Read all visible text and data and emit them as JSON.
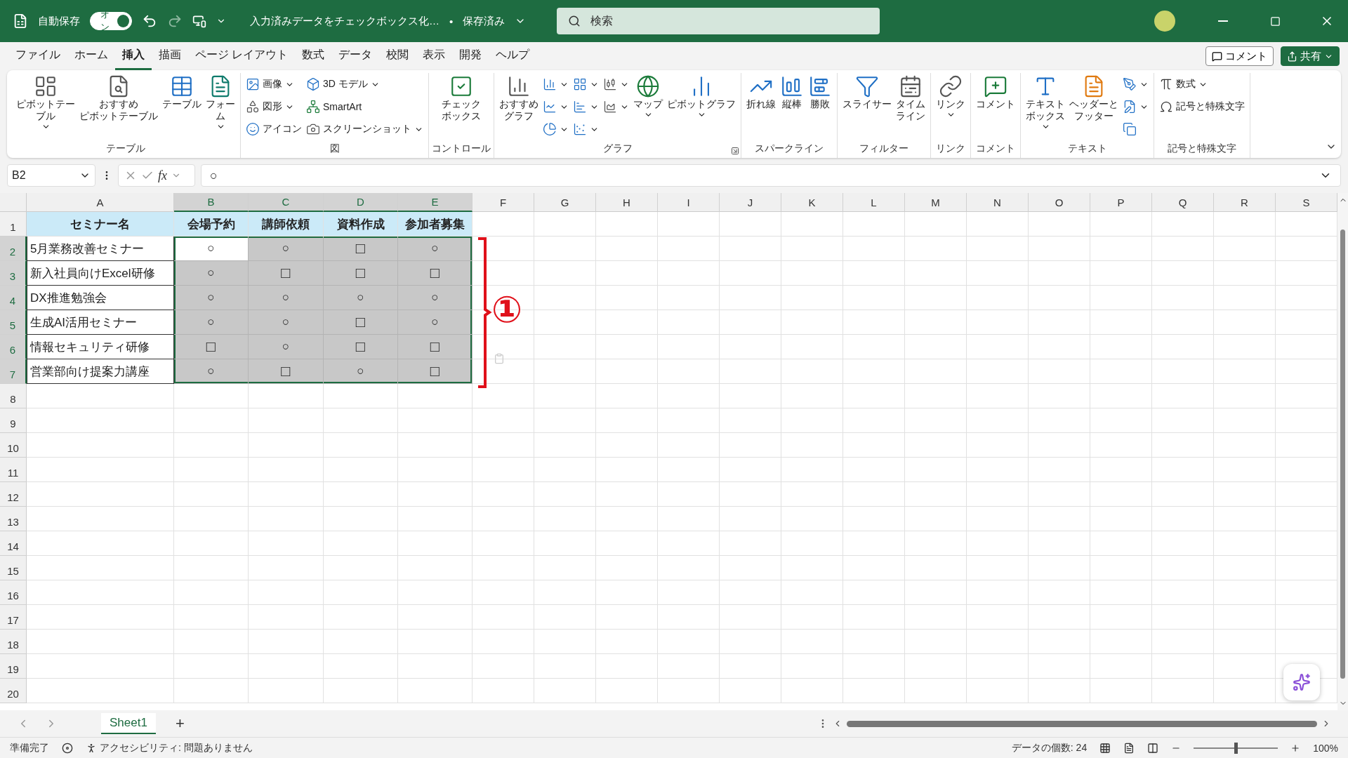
{
  "title_bar": {
    "autosave_label": "自動保存",
    "autosave": {
      "label": "オン",
      "on": true
    },
    "redo_disabled": true,
    "document_title": "入力済みデータをチェックボックス化…",
    "separator": "•",
    "save_status": "保存済み",
    "search": {
      "placeholder": "検索"
    }
  },
  "menu": {
    "tabs": [
      {
        "label": "ファイル",
        "selected": false
      },
      {
        "label": "ホーム",
        "selected": false
      },
      {
        "label": "挿入",
        "selected": true
      },
      {
        "label": "描画",
        "selected": false
      },
      {
        "label": "ページ レイアウト",
        "selected": false
      },
      {
        "label": "数式",
        "selected": false
      },
      {
        "label": "データ",
        "selected": false
      },
      {
        "label": "校閲",
        "selected": false
      },
      {
        "label": "表示",
        "selected": false
      },
      {
        "label": "開発",
        "selected": false
      },
      {
        "label": "ヘルプ",
        "selected": false
      }
    ],
    "comment_button": "コメント",
    "share_button": "共有"
  },
  "ribbon": [
    {
      "label": "テーブル",
      "items": [
        {
          "kind": "large",
          "lines": [
            "ピボットテー",
            "ブル"
          ],
          "dropdown": true
        },
        {
          "kind": "large",
          "lines": [
            "おすすめ",
            "ピボットテーブル"
          ],
          "dropdown": false
        },
        {
          "kind": "large",
          "lines": [
            "テーブル"
          ],
          "dropdown": false
        },
        {
          "kind": "large",
          "lines": [
            "フォー",
            "ム"
          ],
          "dropdown": true
        }
      ]
    },
    {
      "label": "図",
      "items": [
        {
          "kind": "stack",
          "entries": [
            {
              "label": "画像",
              "dropdown": true
            },
            {
              "label": "図形",
              "dropdown": true
            },
            {
              "label": "アイコン",
              "dropdown": false
            }
          ]
        },
        {
          "kind": "stack",
          "entries": [
            {
              "label": "3D モデル",
              "dropdown": true
            },
            {
              "label": "SmartArt",
              "dropdown": false
            },
            {
              "label": "スクリーンショット",
              "dropdown": true
            }
          ]
        }
      ]
    },
    {
      "label": "コントロール",
      "items": [
        {
          "kind": "large",
          "lines": [
            "チェック",
            "ボックス"
          ],
          "dropdown": false
        }
      ]
    },
    {
      "label": "グラフ",
      "launcher": true,
      "items": [
        {
          "kind": "large",
          "lines": [
            "おすすめ",
            "グラフ"
          ],
          "dropdown": false
        },
        {
          "kind": "stack",
          "entries": [
            {
              "dropdown": true
            },
            {
              "dropdown": true
            },
            {
              "dropdown": true
            }
          ]
        },
        {
          "kind": "stack",
          "entries": [
            {
              "dropdown": true
            },
            {
              "dropdown": true
            },
            {
              "dropdown": true
            }
          ]
        },
        {
          "kind": "stack",
          "entries": [
            {
              "dropdown": true
            },
            {
              "dropdown": true
            }
          ]
        },
        {
          "kind": "large",
          "lines": [
            "マップ"
          ],
          "dropdown": true
        },
        {
          "kind": "large",
          "lines": [
            "ピボットグラフ"
          ],
          "dropdown": true
        }
      ]
    },
    {
      "label": "スパークライン",
      "items": [
        {
          "kind": "large",
          "lines": [
            "折れ線"
          ],
          "dropdown": false
        },
        {
          "kind": "large",
          "lines": [
            "縦棒"
          ],
          "dropdown": false
        },
        {
          "kind": "large",
          "lines": [
            "勝敗"
          ],
          "dropdown": false
        }
      ]
    },
    {
      "label": "フィルター",
      "items": [
        {
          "kind": "large",
          "lines": [
            "スライサー"
          ],
          "dropdown": false
        },
        {
          "kind": "large",
          "lines": [
            "タイム",
            "ライン"
          ],
          "dropdown": false
        }
      ]
    },
    {
      "label": "リンク",
      "items": [
        {
          "kind": "large",
          "lines": [
            "リンク"
          ],
          "dropdown": true
        }
      ]
    },
    {
      "label": "コメント",
      "items": [
        {
          "kind": "large",
          "lines": [
            "コメント"
          ],
          "dropdown": false
        }
      ]
    },
    {
      "label": "テキスト",
      "items": [
        {
          "kind": "large",
          "lines": [
            "テキスト",
            "ボックス"
          ],
          "dropdown": true
        },
        {
          "kind": "large",
          "lines": [
            "ヘッダーと",
            "フッター"
          ],
          "dropdown": false
        },
        {
          "kind": "stack",
          "entries": [
            {
              "dropdown": true
            },
            {
              "dropdown": true
            },
            {
              "dropdown": false
            }
          ]
        }
      ]
    },
    {
      "label": "記号と特殊文字",
      "items": [
        {
          "kind": "stack",
          "entries": [
            {
              "label": "数式",
              "dropdown": true
            },
            {
              "label": "記号と特殊文字",
              "dropdown": false
            }
          ]
        }
      ]
    }
  ],
  "formula_bar": {
    "name_box": "B2",
    "fx": "fx",
    "value": "○"
  },
  "sheet": {
    "columns": [
      {
        "label": "A",
        "selected": false
      },
      {
        "label": "B",
        "selected": true
      },
      {
        "label": "C",
        "selected": true
      },
      {
        "label": "D",
        "selected": true
      },
      {
        "label": "E",
        "selected": true
      },
      {
        "label": "F",
        "selected": false
      },
      {
        "label": "G",
        "selected": false
      },
      {
        "label": "H",
        "selected": false
      },
      {
        "label": "I",
        "selected": false
      },
      {
        "label": "J",
        "selected": false
      },
      {
        "label": "K",
        "selected": false
      },
      {
        "label": "L",
        "selected": false
      },
      {
        "label": "M",
        "selected": false
      },
      {
        "label": "N",
        "selected": false
      },
      {
        "label": "O",
        "selected": false
      },
      {
        "label": "P",
        "selected": false
      },
      {
        "label": "Q",
        "selected": false
      },
      {
        "label": "R",
        "selected": false
      },
      {
        "label": "S",
        "selected": false
      }
    ],
    "header_row": {
      "number": "1",
      "cells": [
        "セミナー名",
        "会場予約",
        "講師依頼",
        "資料作成",
        "参加者募集"
      ]
    },
    "rows": [
      {
        "number": "2",
        "selected": true,
        "cells": [
          {
            "text": "5月業務改善セミナー",
            "active": false
          },
          {
            "text": "○",
            "active": true
          },
          {
            "text": "○",
            "active": false
          },
          {
            "text": "□",
            "active": false
          },
          {
            "text": "○",
            "active": false
          }
        ]
      },
      {
        "number": "3",
        "selected": true,
        "cells": [
          {
            "text": "新入社員向けExcel研修",
            "active": false
          },
          {
            "text": "○",
            "active": false
          },
          {
            "text": "□",
            "active": false
          },
          {
            "text": "□",
            "active": false
          },
          {
            "text": "□",
            "active": false
          }
        ]
      },
      {
        "number": "4",
        "selected": true,
        "cells": [
          {
            "text": "DX推進勉強会",
            "active": false
          },
          {
            "text": "○",
            "active": false
          },
          {
            "text": "○",
            "active": false
          },
          {
            "text": "○",
            "active": false
          },
          {
            "text": "○",
            "active": false
          }
        ]
      },
      {
        "number": "5",
        "selected": true,
        "cells": [
          {
            "text": "生成AI活用セミナー",
            "active": false
          },
          {
            "text": "○",
            "active": false
          },
          {
            "text": "○",
            "active": false
          },
          {
            "text": "□",
            "active": false
          },
          {
            "text": "○",
            "active": false
          }
        ]
      },
      {
        "number": "6",
        "selected": true,
        "cells": [
          {
            "text": "情報セキュリティ研修",
            "active": false
          },
          {
            "text": "□",
            "active": false
          },
          {
            "text": "○",
            "active": false
          },
          {
            "text": "□",
            "active": false
          },
          {
            "text": "□",
            "active": false
          }
        ]
      },
      {
        "number": "7",
        "selected": true,
        "cells": [
          {
            "text": "営業部向け提案力講座",
            "active": false
          },
          {
            "text": "○",
            "active": false
          },
          {
            "text": "□",
            "active": false
          },
          {
            "text": "○",
            "active": false
          },
          {
            "text": "□",
            "active": false
          }
        ]
      }
    ],
    "empty_rows": [
      "8",
      "9",
      "10",
      "11",
      "12",
      "13",
      "14",
      "15",
      "16",
      "17",
      "18",
      "19",
      "20"
    ],
    "callout": "①"
  },
  "sheet_tabs": [
    {
      "label": "Sheet1",
      "selected": true
    }
  ],
  "add_sheet": "+",
  "status_bar": {
    "ready": "準備完了",
    "accessibility": "アクセシビリティ: 問題ありません",
    "count": "データの個数: 24",
    "zoom": {
      "level": 0.5,
      "label": "100%"
    }
  }
}
